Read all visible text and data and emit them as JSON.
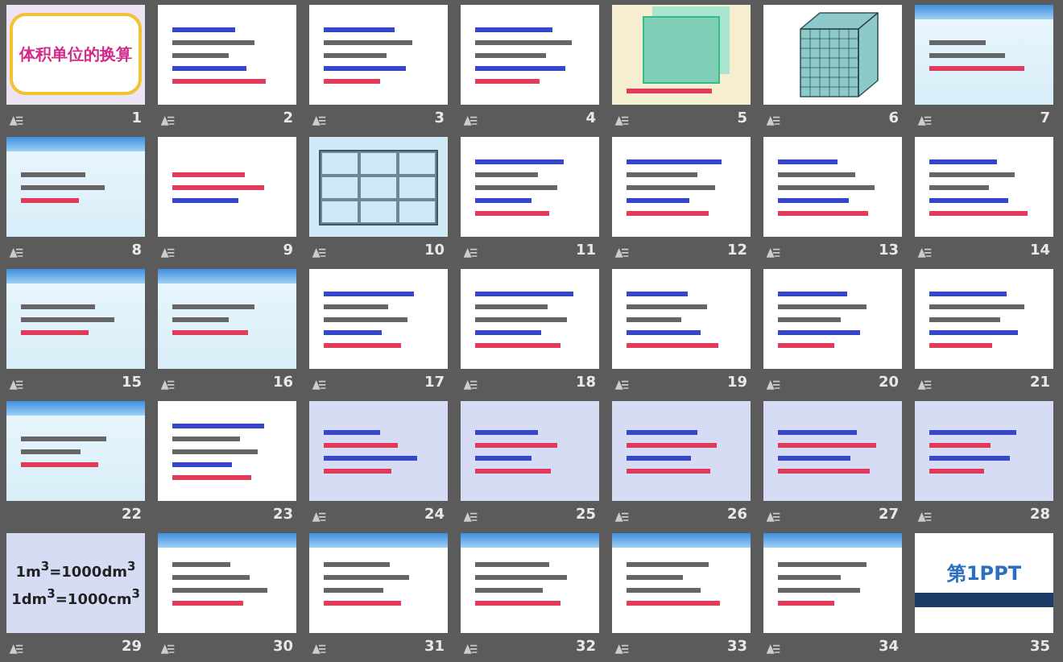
{
  "slides": [
    {
      "number": "1",
      "kind": "title",
      "animated": true,
      "title": "体积单位的换算"
    },
    {
      "number": "2",
      "kind": "white",
      "animated": true
    },
    {
      "number": "3",
      "kind": "white",
      "animated": true
    },
    {
      "number": "4",
      "kind": "white",
      "animated": true
    },
    {
      "number": "5",
      "kind": "cube",
      "animated": true
    },
    {
      "number": "6",
      "kind": "grid",
      "animated": true
    },
    {
      "number": "7",
      "kind": "sky",
      "animated": true
    },
    {
      "number": "8",
      "kind": "sky",
      "animated": true
    },
    {
      "number": "9",
      "kind": "panel",
      "animated": true
    },
    {
      "number": "10",
      "kind": "table",
      "animated": true
    },
    {
      "number": "11",
      "kind": "white",
      "animated": true
    },
    {
      "number": "12",
      "kind": "white",
      "animated": true
    },
    {
      "number": "13",
      "kind": "white",
      "animated": true
    },
    {
      "number": "14",
      "kind": "white",
      "animated": true
    },
    {
      "number": "15",
      "kind": "sky",
      "animated": true
    },
    {
      "number": "16",
      "kind": "sky",
      "animated": true
    },
    {
      "number": "17",
      "kind": "white",
      "animated": true
    },
    {
      "number": "18",
      "kind": "white",
      "animated": true
    },
    {
      "number": "19",
      "kind": "white",
      "animated": true
    },
    {
      "number": "20",
      "kind": "white",
      "animated": true
    },
    {
      "number": "21",
      "kind": "white",
      "animated": true
    },
    {
      "number": "22",
      "kind": "sky",
      "animated": false
    },
    {
      "number": "23",
      "kind": "white",
      "animated": false
    },
    {
      "number": "24",
      "kind": "lavender",
      "animated": true
    },
    {
      "number": "25",
      "kind": "lavender",
      "animated": true
    },
    {
      "number": "26",
      "kind": "lavender",
      "animated": true
    },
    {
      "number": "27",
      "kind": "lavender",
      "animated": true
    },
    {
      "number": "28",
      "kind": "lavender",
      "animated": true
    },
    {
      "number": "29",
      "kind": "lavender",
      "animated": true,
      "lines": [
        "1m$^{3}$=1000dm$^{3}$",
        "1dm$^{3}$=1000cm$^{3}$"
      ]
    },
    {
      "number": "30",
      "kind": "banner",
      "animated": true
    },
    {
      "number": "31",
      "kind": "banner",
      "animated": true
    },
    {
      "number": "32",
      "kind": "banner",
      "animated": true
    },
    {
      "number": "33",
      "kind": "banner",
      "animated": true
    },
    {
      "number": "34",
      "kind": "banner",
      "animated": true
    },
    {
      "number": "35",
      "kind": "logo",
      "animated": false,
      "title": "第1PPT"
    }
  ]
}
